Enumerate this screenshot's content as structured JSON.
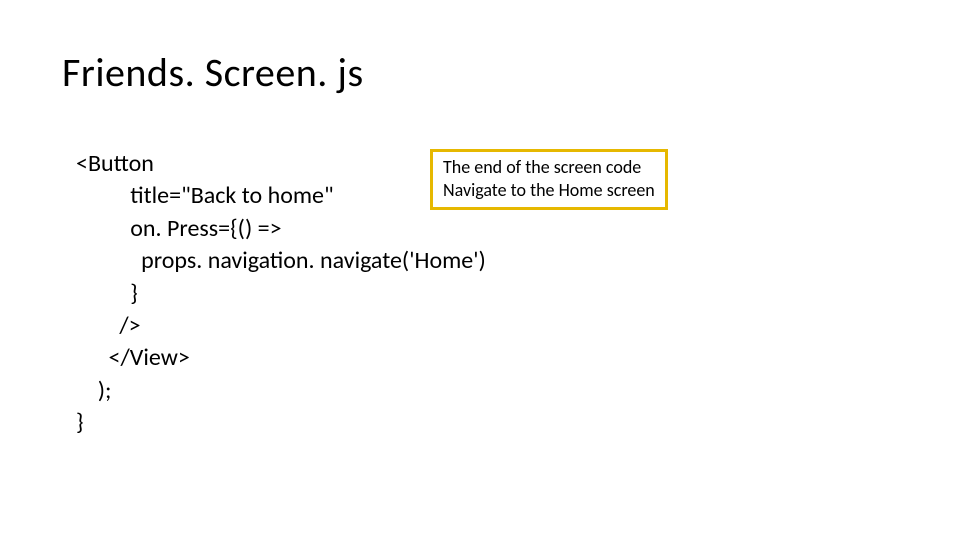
{
  "title": "Friends. Screen. js",
  "code": "<Button\n          title=\"Back to home\"\n          on. Press={() =>\n            props. navigation. navigate('Home')\n          }\n        />\n      </View>\n    );\n}",
  "callout": {
    "line1": "The end of the screen code",
    "line2": "Navigate to the Home screen"
  },
  "colors": {
    "callout_border": "#e6b800"
  }
}
